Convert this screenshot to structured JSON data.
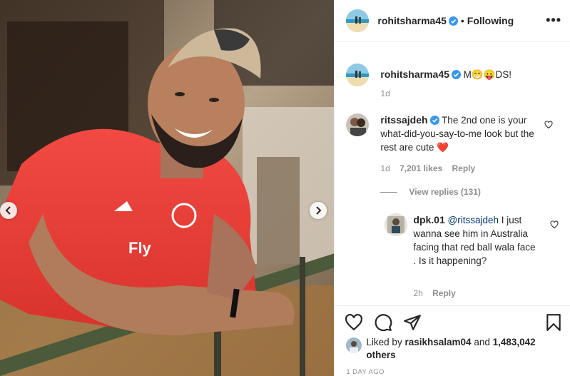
{
  "post_author": {
    "username": "rohitsharma45",
    "separator": "•",
    "follow_status": "Following",
    "more_glyph": "•••"
  },
  "caption": {
    "username": "rohitsharma45",
    "text_start": "M",
    "emoji_1": "😁",
    "emoji_2": "😛",
    "text_end": "DS!",
    "time": "1d"
  },
  "comments": [
    {
      "username": "ritssajdeh",
      "text": "The 2nd one is your what-did-you-say-to-me look but the rest are cute",
      "emoji": "❤️",
      "time": "1d",
      "likes": "7,201 likes",
      "reply_label": "Reply",
      "view_replies": "View replies (131)"
    },
    {
      "username": "dpk.01",
      "mention": "@ritssajdeh",
      "text": "I just wanna see him in Australia facing that red ball wala face . Is it happening?",
      "time": "2h",
      "reply_label": "Reply"
    }
  ],
  "likes": {
    "prefix": "Liked by",
    "liker": "rasikhsalam04",
    "and": "and",
    "others": "1,483,042 others"
  },
  "timestamp": "1 DAY AGO",
  "icons": {
    "like": "heart-icon",
    "comment": "comment-icon",
    "share": "paper-plane-icon",
    "save": "bookmark-icon",
    "prev": "chevron-left-icon",
    "next": "chevron-right-icon",
    "verified": "verified-badge-icon"
  },
  "colors": {
    "verified_blue": "#3897f0",
    "jersey_red": "#ef3b3b",
    "heart_red": "#ed4956"
  }
}
